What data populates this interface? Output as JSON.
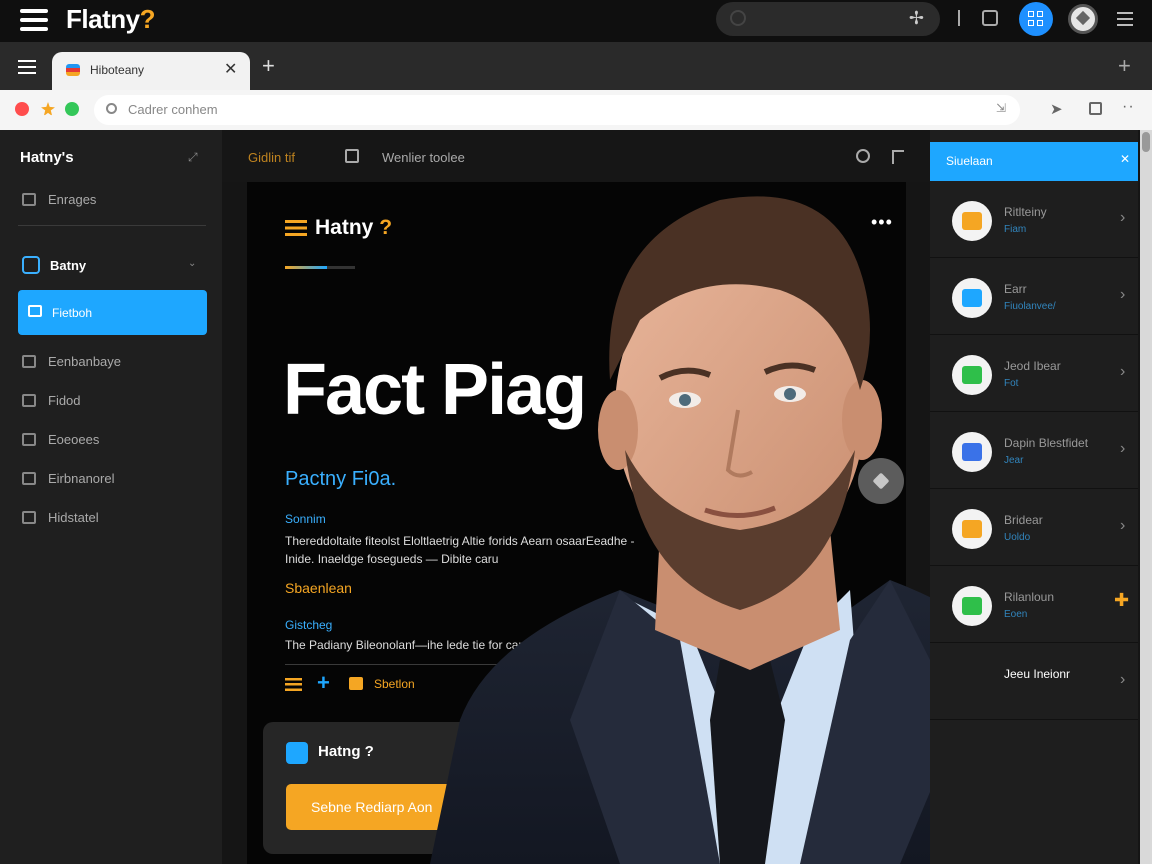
{
  "app": {
    "brand": "Flatny",
    "brand_mark": "?"
  },
  "top_search": {
    "placeholder": ""
  },
  "tab": {
    "title": "Hiboteany"
  },
  "address": {
    "url": "Cadrer conhem"
  },
  "sidebar": {
    "title": "Hatny's",
    "items": [
      {
        "label": "Enrages",
        "icon": "copy-icon"
      },
      {
        "label": "Fietboh",
        "icon": "layout-icon"
      },
      {
        "label": "Eenbanbaye",
        "icon": "building-icon"
      },
      {
        "label": "Fidod",
        "icon": "file-icon"
      },
      {
        "label": "Eoeoees",
        "icon": "briefcase-icon"
      },
      {
        "label": "Eirbnanorel",
        "icon": "monitor-icon"
      },
      {
        "label": "Hidstatel",
        "icon": "printer-icon"
      }
    ],
    "group": {
      "label": "Batny"
    }
  },
  "main_toolbar": {
    "label_left": "Gidlin tif",
    "label_right": "Wenlier toolee"
  },
  "card": {
    "brand": "Hatny",
    "brand_mark": "?",
    "hero_title": "Fact Piag",
    "hero_subtitle": "Pactny Fi0a.",
    "section1_heading": "Sonnim",
    "section1_body": "Thereddoltaite fiteolst  Eloltlaetrig Altie forids Aearn osaarEeadhe - Inide. Inaeldge fosegueds — Dibite caru",
    "section2_heading": "Sbaenlean",
    "section3_heading": "Gistcheg",
    "section3_body": "The Padiany Bileonolanf—ihe lede tie for canfaanr",
    "action_label": "Sbetlon"
  },
  "mini_card": {
    "title": "Hatng ?",
    "button_label": "Sebne Rediarp Aon"
  },
  "right_panel": {
    "title": "Siuelaan",
    "items": [
      {
        "title": "Ritlteiny",
        "subtitle": "Fiam",
        "icon_color": "#f5a623"
      },
      {
        "title": "Earr",
        "subtitle": "Fiuolanvee/",
        "icon_color": "#1ea7ff"
      },
      {
        "title": "Jeod Ibear",
        "subtitle": "Fot",
        "icon_color": "#2fbf4a"
      },
      {
        "title": "Dapin Blestfidet",
        "subtitle": "Jear",
        "icon_color": "#3a72e8"
      },
      {
        "title": "Bridear",
        "subtitle": "Uoldo",
        "icon_color": "#f5a623"
      },
      {
        "title": "Rilanloun",
        "subtitle": "Eoen",
        "icon_color": "#2fbf4a"
      },
      {
        "title": "Jeeu Ineionr",
        "subtitle": "",
        "icon_color": "#3a72e8"
      }
    ]
  },
  "colors": {
    "accent_blue": "#1ea7ff",
    "accent_orange": "#f5a623",
    "bg": "#151515"
  }
}
